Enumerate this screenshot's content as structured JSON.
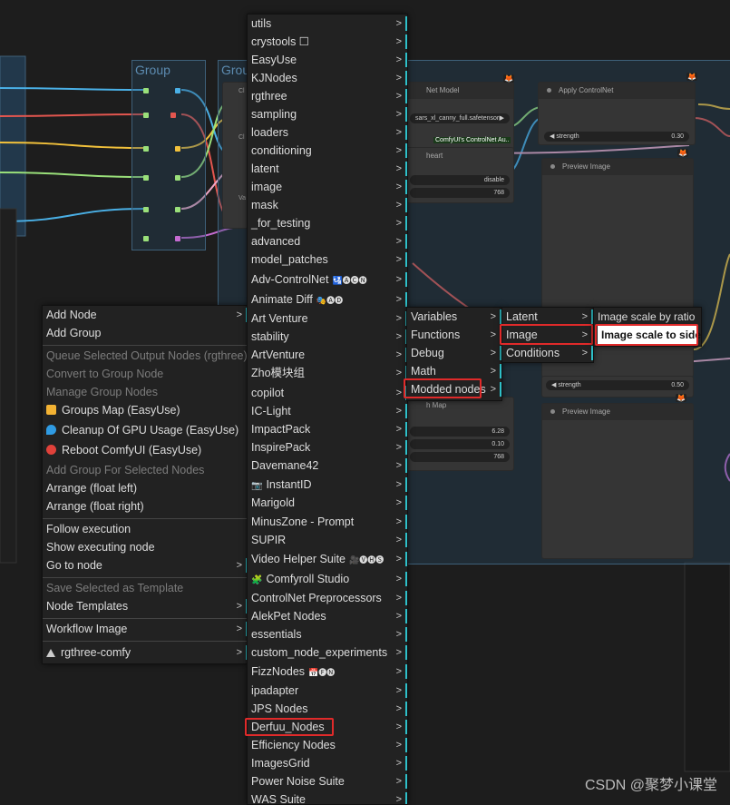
{
  "canvas": {
    "groups": [
      {
        "title": "Group"
      },
      {
        "title": "Grou"
      }
    ],
    "nodes": {
      "controlnet_model": {
        "title": "Net Model",
        "model": "sars_xl_canny_full.safetensors",
        "tag": "ComfyUI's ControlNet Au.."
      },
      "apply_controlnet": {
        "title": "Apply ControlNet",
        "strength_label": "strength",
        "strength_value": "0.30"
      },
      "preview_image_1": {
        "title": "Preview Image"
      },
      "preview_image_2": {
        "title": "Preview Image"
      },
      "preprocessor": {
        "title": "heart",
        "value1": "disable",
        "value2": "768"
      },
      "apply_controlnet_2": {
        "strength_label": "strength",
        "strength_value": "0.50"
      },
      "depth_map": {
        "title": "h Map",
        "value1": "6.28",
        "value2": "0.10",
        "value3": "768"
      },
      "left_stubs": {
        "s1": "Cl",
        "s2": "Cl",
        "s3": "Va"
      }
    }
  },
  "context_menu": {
    "items": [
      {
        "label": "Add Node",
        "submenu": true
      },
      {
        "label": "Add Group"
      },
      {
        "label": "Queue Selected Output Nodes (rgthree)",
        "disabled": true
      },
      {
        "label": "Convert to Group Node",
        "disabled": true
      },
      {
        "label": "Manage Group Nodes",
        "disabled": true
      },
      {
        "label": "Groups Map (EasyUse)",
        "icon": "groups-map-icon"
      },
      {
        "label": "Cleanup Of GPU Usage (EasyUse)",
        "icon": "gpu-cleanup-icon"
      },
      {
        "label": "Reboot ComfyUI (EasyUse)",
        "icon": "reboot-icon"
      },
      {
        "label": "Add Group For Selected Nodes",
        "disabled": true
      },
      {
        "label": "Arrange (float left)"
      },
      {
        "label": "Arrange (float right)"
      },
      {
        "label": "Follow execution"
      },
      {
        "label": "Show executing node"
      },
      {
        "label": "Go to node",
        "submenu": true
      },
      {
        "label": "Save Selected as Template",
        "disabled": true
      },
      {
        "label": "Node Templates",
        "submenu": true
      },
      {
        "label": "Workflow Image",
        "submenu": true
      },
      {
        "label": "rgthree-comfy",
        "submenu": true,
        "icon": "rgthree-icon"
      }
    ]
  },
  "category_menu": {
    "items": [
      "utils",
      "crystools ☐",
      "EasyUse",
      "KJNodes",
      "rgthree",
      "sampling",
      "loaders",
      "conditioning",
      "latent",
      "image",
      "mask",
      "_for_testing",
      "advanced",
      "model_patches",
      "Adv-ControlNet",
      "Animate Diff",
      "Art Venture",
      "stability",
      "ArtVenture",
      "Zho模块组",
      "copilot",
      "IC-Light",
      "ImpactPack",
      "InspirePack",
      "Davemane42",
      "InstantID",
      "Marigold",
      "MinusZone - Prompt",
      "SUPIR",
      "Video Helper Suite",
      "Comfyroll Studio",
      "ControlNet Preprocessors",
      "AlekPet Nodes",
      "essentials",
      "custom_node_experiments",
      "FizzNodes",
      "ipadapter",
      "JPS Nodes",
      "Derfuu_Nodes",
      "Efficiency Nodes",
      "ImagesGrid",
      "Power Noise Suite",
      "WAS Suite"
    ],
    "badges": {
      "adv_controlnet": "🛂🅐🅒🅝",
      "animate_diff": "🎭🅐🅓",
      "instantid_icon": "📷",
      "video_helper": "🎥🅥🅗🅢",
      "comfyroll": "🧩",
      "fizz": "📅🅕🅝"
    }
  },
  "derfuu_menu": {
    "items": [
      "Variables",
      "Functions",
      "Debug",
      "Math",
      "Modded nodes"
    ]
  },
  "modded_menu": {
    "items": [
      "Latent",
      "Image",
      "Conditions"
    ]
  },
  "image_menu": {
    "items": [
      "Image scale by ratio",
      "Image scale to side"
    ]
  },
  "watermark": "CSDN @聚梦小课堂",
  "arrow": ">",
  "colors": {
    "highlight": "#e02a2a",
    "accent": "#2ec0c9"
  }
}
